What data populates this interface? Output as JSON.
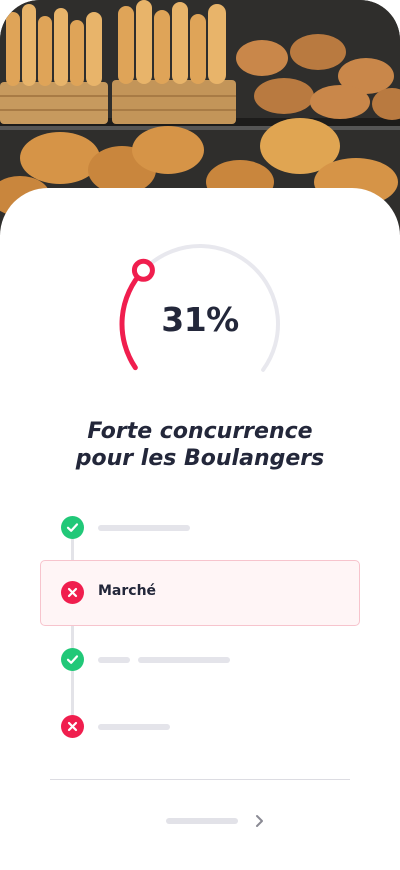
{
  "hero": {
    "image": "bakery-bread-shelves",
    "colors": {
      "wall": "#2f2e2c",
      "basket": "#c79a5e",
      "bread": "#d89a4e"
    }
  },
  "gauge": {
    "value_label": "31%",
    "value_fraction": 0.31,
    "colors": {
      "track": "#e8e8ee",
      "fill": "#f01e4e"
    }
  },
  "title": {
    "line1": "Forte concurrence",
    "line2": "pour les Boulangers"
  },
  "steps": [
    {
      "status": "ok",
      "icon": "check-icon",
      "label": ""
    },
    {
      "status": "ko",
      "icon": "cross-icon",
      "label": "Marché",
      "highlighted": true
    },
    {
      "status": "ok",
      "icon": "check-icon",
      "label": ""
    },
    {
      "status": "ko",
      "icon": "cross-icon",
      "label": ""
    }
  ],
  "colors": {
    "ok": "#21c878",
    "ko": "#f01e4e",
    "text": "#23273a",
    "placeholder": "#e4e4ea"
  },
  "footer": {
    "next_icon": "chevron-right-icon"
  }
}
